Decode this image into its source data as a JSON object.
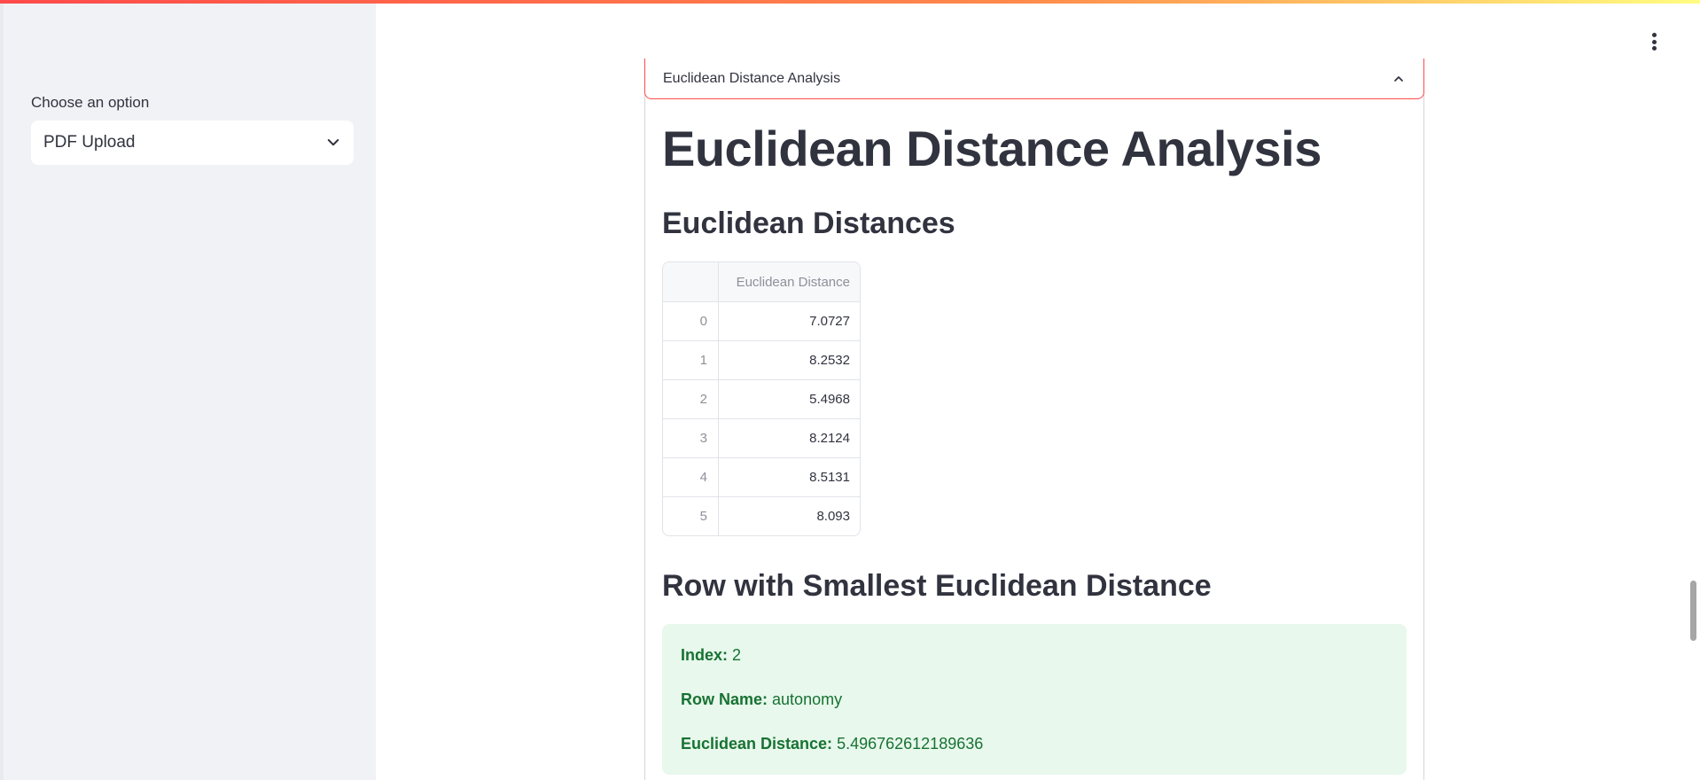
{
  "sidebar": {
    "label": "Choose an option",
    "select_value": "PDF Upload"
  },
  "expander": {
    "title": "Euclidean Distance Analysis"
  },
  "main": {
    "title": "Euclidean Distance Analysis",
    "distances_heading": "Euclidean Distances",
    "smallest_heading": "Row with Smallest Euclidean Distance"
  },
  "table": {
    "index_header": "",
    "column_header": "Euclidean Distance",
    "rows": [
      {
        "index": "0",
        "value": "7.0727"
      },
      {
        "index": "1",
        "value": "8.2532"
      },
      {
        "index": "2",
        "value": "5.4968"
      },
      {
        "index": "3",
        "value": "8.2124"
      },
      {
        "index": "4",
        "value": "8.5131"
      },
      {
        "index": "5",
        "value": "8.093"
      }
    ]
  },
  "result": {
    "index_label": "Index:",
    "index_value": "2",
    "row_name_label": "Row Name:",
    "row_name_value": "autonomy",
    "distance_label": "Euclidean Distance:",
    "distance_value": "5.496762612189636"
  },
  "colors": {
    "accent": "#ff4b4b",
    "success_bg": "#e8f8ec",
    "success_text": "#177233",
    "sidebar_bg": "#f0f2f6"
  },
  "icons": {
    "select_chevron": "chevron-down-icon",
    "expander_caret": "chevron-up-icon",
    "main_menu": "more-vertical-icon"
  }
}
